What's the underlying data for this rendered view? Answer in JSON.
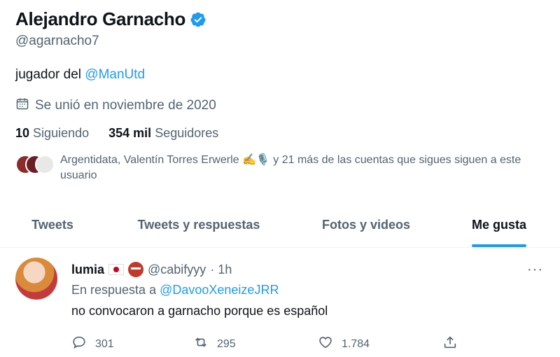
{
  "profile": {
    "name": "Alejandro Garnacho",
    "handle": "@agarnacho7",
    "bio_text": "jugador del ",
    "bio_link": "@ManUtd",
    "joined": "Se unió en noviembre de 2020",
    "following_count": "10",
    "following_label": "Siguiendo",
    "followers_count": "354 mil",
    "followers_label": "Seguidores",
    "followed_by": "Argentidata, Valentín Torres Erwerle ✍️🎙️ y 21 más de las cuentas que sigues siguen a este usuario"
  },
  "tabs": [
    {
      "label": "Tweets"
    },
    {
      "label": "Tweets y respuestas"
    },
    {
      "label": "Fotos y videos"
    },
    {
      "label": "Me gusta"
    }
  ],
  "tweet": {
    "author": "lumia",
    "handle": "@cabifyyy",
    "time": "· 1h",
    "reply_prefix": "En respuesta a ",
    "reply_handle": "@DavooXeneizeJRR",
    "text": "no convocaron a garnacho porque es español",
    "replies": "301",
    "retweets": "295",
    "likes": "1.784",
    "more": "···"
  },
  "colors": {
    "accent": "#1d9bf0",
    "muted": "#536471",
    "text": "#0f1419"
  }
}
